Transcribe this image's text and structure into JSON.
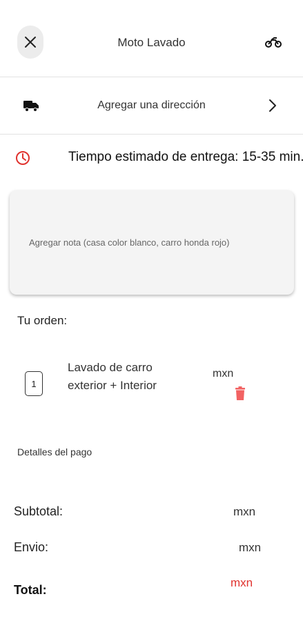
{
  "header": {
    "title": "Moto Lavado",
    "close_icon": "close-icon",
    "service_icon": "motorcycle-icon"
  },
  "address": {
    "label": "Agregar una dirección",
    "icon": "truck-icon",
    "chevron": "chevron-right-icon"
  },
  "delivery": {
    "text": "Tiempo estimado de entrega: 15-35 min.",
    "icon": "clock-icon",
    "icon_color": "#e0322e"
  },
  "note": {
    "placeholder": "Agregar nota (casa color blanco, carro honda rojo)"
  },
  "order": {
    "title": "Tu orden:",
    "items": [
      {
        "quantity": "1",
        "name": "Lavado de carro exterior + Interior",
        "price": "mxn"
      }
    ],
    "delete_icon_color": "#f26262"
  },
  "payment": {
    "title": "Detalles del pago",
    "subtotal_label": "Subtotal:",
    "subtotal_value": "mxn",
    "shipping_label": "Envio:",
    "shipping_value": "mxn",
    "total_label": "Total:",
    "total_value": "mxn",
    "total_color": "#e0322e"
  }
}
